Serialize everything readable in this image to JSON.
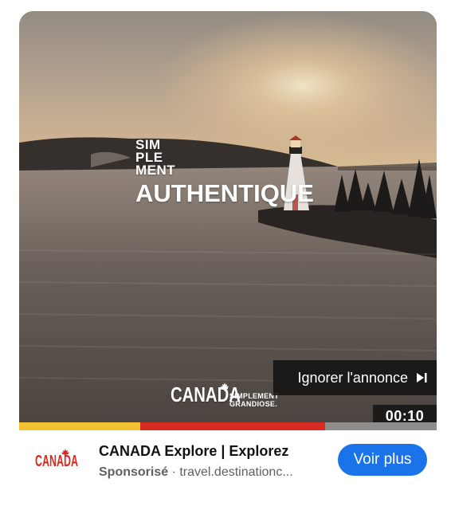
{
  "video": {
    "overlay_lines": [
      "SIM",
      "PLE",
      "MENT",
      "AUTHENTIQUE"
    ],
    "brand_word": "CANADA",
    "brand_tagline": [
      "SIMPLEMENT",
      "GRANDIOSE."
    ],
    "skip_label": "Ignorer l'annonce",
    "timer": "00:10",
    "progress_fraction": 0.29
  },
  "ad": {
    "title": "CANADA Explore | Explorez",
    "sponsored_label": "Sponsorisé",
    "separator": " · ",
    "domain": "travel.destinationc...",
    "cta_label": "Voir plus",
    "logo_text": "CANADA"
  },
  "colors": {
    "progress_played": "#f1c232",
    "progress_accent": "#d62a20",
    "cta": "#1a73e8",
    "brand_red": "#d62a20"
  }
}
